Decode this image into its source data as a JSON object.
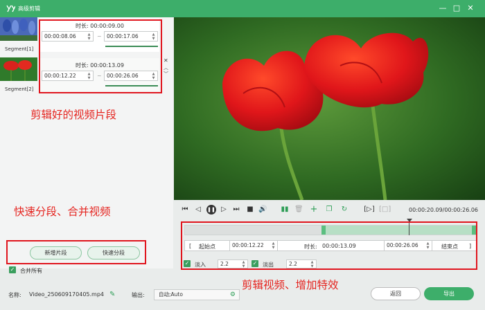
{
  "window": {
    "title": "高级剪辑"
  },
  "segments": [
    {
      "name": "Segment[1]",
      "duration_label": "时长:",
      "duration": "00:00:09.00",
      "start": "00:00:08.06",
      "end": "00:00:17.06"
    },
    {
      "name": "Segment[2]",
      "duration_label": "时长:",
      "duration": "00:00:13.09",
      "start": "00:00:12.22",
      "end": "00:00:26.06"
    }
  ],
  "annotations": {
    "clips": "剪辑好的视频片段",
    "split_merge": "快速分段、合并视频",
    "edit_effects": "剪辑视频、增加特效"
  },
  "left_actions": {
    "add_segment": "新增片段",
    "quick_split": "快速分段",
    "merge_all": "合并所有"
  },
  "playback": {
    "time": "00:00:20.09/00:00:26.06"
  },
  "timeline": {
    "selection_start": 0.469,
    "selection_end": 1.0,
    "playhead": 0.77
  },
  "trim": {
    "start_label": "起始点",
    "start_value": "00:00:12.22",
    "duration_label": "时长:",
    "duration_value": "00:00:13.09",
    "end_value": "00:00:26.06",
    "end_label": "结束点"
  },
  "fade": {
    "in_label": "淡入",
    "in_value": "2.2",
    "out_label": "淡出",
    "out_value": "2.2"
  },
  "bottom": {
    "name_label": "名称:",
    "file_name": "Video_250609170405.mp4",
    "output_label": "输出:",
    "output_value": "自动;Auto",
    "return_label": "返回",
    "export_label": "导出"
  },
  "colors": {
    "accent": "#3dae6a",
    "annotation": "#e0141d"
  }
}
